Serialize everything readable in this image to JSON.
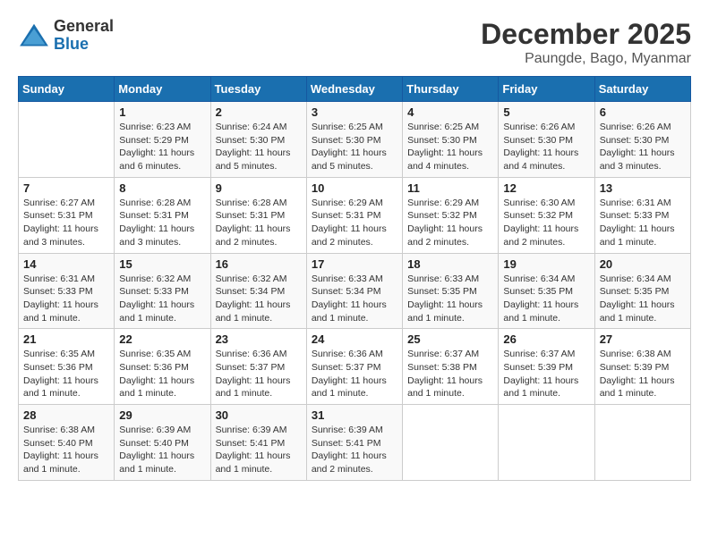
{
  "header": {
    "logo_general": "General",
    "logo_blue": "Blue",
    "month_year": "December 2025",
    "location": "Paungde, Bago, Myanmar"
  },
  "days_of_week": [
    "Sunday",
    "Monday",
    "Tuesday",
    "Wednesday",
    "Thursday",
    "Friday",
    "Saturday"
  ],
  "weeks": [
    [
      {
        "day": "",
        "info": ""
      },
      {
        "day": "1",
        "info": "Sunrise: 6:23 AM\nSunset: 5:29 PM\nDaylight: 11 hours and 6 minutes."
      },
      {
        "day": "2",
        "info": "Sunrise: 6:24 AM\nSunset: 5:30 PM\nDaylight: 11 hours and 5 minutes."
      },
      {
        "day": "3",
        "info": "Sunrise: 6:25 AM\nSunset: 5:30 PM\nDaylight: 11 hours and 5 minutes."
      },
      {
        "day": "4",
        "info": "Sunrise: 6:25 AM\nSunset: 5:30 PM\nDaylight: 11 hours and 4 minutes."
      },
      {
        "day": "5",
        "info": "Sunrise: 6:26 AM\nSunset: 5:30 PM\nDaylight: 11 hours and 4 minutes."
      },
      {
        "day": "6",
        "info": "Sunrise: 6:26 AM\nSunset: 5:30 PM\nDaylight: 11 hours and 3 minutes."
      }
    ],
    [
      {
        "day": "7",
        "info": "Sunrise: 6:27 AM\nSunset: 5:31 PM\nDaylight: 11 hours and 3 minutes."
      },
      {
        "day": "8",
        "info": "Sunrise: 6:28 AM\nSunset: 5:31 PM\nDaylight: 11 hours and 3 minutes."
      },
      {
        "day": "9",
        "info": "Sunrise: 6:28 AM\nSunset: 5:31 PM\nDaylight: 11 hours and 2 minutes."
      },
      {
        "day": "10",
        "info": "Sunrise: 6:29 AM\nSunset: 5:31 PM\nDaylight: 11 hours and 2 minutes."
      },
      {
        "day": "11",
        "info": "Sunrise: 6:29 AM\nSunset: 5:32 PM\nDaylight: 11 hours and 2 minutes."
      },
      {
        "day": "12",
        "info": "Sunrise: 6:30 AM\nSunset: 5:32 PM\nDaylight: 11 hours and 2 minutes."
      },
      {
        "day": "13",
        "info": "Sunrise: 6:31 AM\nSunset: 5:33 PM\nDaylight: 11 hours and 1 minute."
      }
    ],
    [
      {
        "day": "14",
        "info": "Sunrise: 6:31 AM\nSunset: 5:33 PM\nDaylight: 11 hours and 1 minute."
      },
      {
        "day": "15",
        "info": "Sunrise: 6:32 AM\nSunset: 5:33 PM\nDaylight: 11 hours and 1 minute."
      },
      {
        "day": "16",
        "info": "Sunrise: 6:32 AM\nSunset: 5:34 PM\nDaylight: 11 hours and 1 minute."
      },
      {
        "day": "17",
        "info": "Sunrise: 6:33 AM\nSunset: 5:34 PM\nDaylight: 11 hours and 1 minute."
      },
      {
        "day": "18",
        "info": "Sunrise: 6:33 AM\nSunset: 5:35 PM\nDaylight: 11 hours and 1 minute."
      },
      {
        "day": "19",
        "info": "Sunrise: 6:34 AM\nSunset: 5:35 PM\nDaylight: 11 hours and 1 minute."
      },
      {
        "day": "20",
        "info": "Sunrise: 6:34 AM\nSunset: 5:35 PM\nDaylight: 11 hours and 1 minute."
      }
    ],
    [
      {
        "day": "21",
        "info": "Sunrise: 6:35 AM\nSunset: 5:36 PM\nDaylight: 11 hours and 1 minute."
      },
      {
        "day": "22",
        "info": "Sunrise: 6:35 AM\nSunset: 5:36 PM\nDaylight: 11 hours and 1 minute."
      },
      {
        "day": "23",
        "info": "Sunrise: 6:36 AM\nSunset: 5:37 PM\nDaylight: 11 hours and 1 minute."
      },
      {
        "day": "24",
        "info": "Sunrise: 6:36 AM\nSunset: 5:37 PM\nDaylight: 11 hours and 1 minute."
      },
      {
        "day": "25",
        "info": "Sunrise: 6:37 AM\nSunset: 5:38 PM\nDaylight: 11 hours and 1 minute."
      },
      {
        "day": "26",
        "info": "Sunrise: 6:37 AM\nSunset: 5:39 PM\nDaylight: 11 hours and 1 minute."
      },
      {
        "day": "27",
        "info": "Sunrise: 6:38 AM\nSunset: 5:39 PM\nDaylight: 11 hours and 1 minute."
      }
    ],
    [
      {
        "day": "28",
        "info": "Sunrise: 6:38 AM\nSunset: 5:40 PM\nDaylight: 11 hours and 1 minute."
      },
      {
        "day": "29",
        "info": "Sunrise: 6:39 AM\nSunset: 5:40 PM\nDaylight: 11 hours and 1 minute."
      },
      {
        "day": "30",
        "info": "Sunrise: 6:39 AM\nSunset: 5:41 PM\nDaylight: 11 hours and 1 minute."
      },
      {
        "day": "31",
        "info": "Sunrise: 6:39 AM\nSunset: 5:41 PM\nDaylight: 11 hours and 2 minutes."
      },
      {
        "day": "",
        "info": ""
      },
      {
        "day": "",
        "info": ""
      },
      {
        "day": "",
        "info": ""
      }
    ]
  ]
}
